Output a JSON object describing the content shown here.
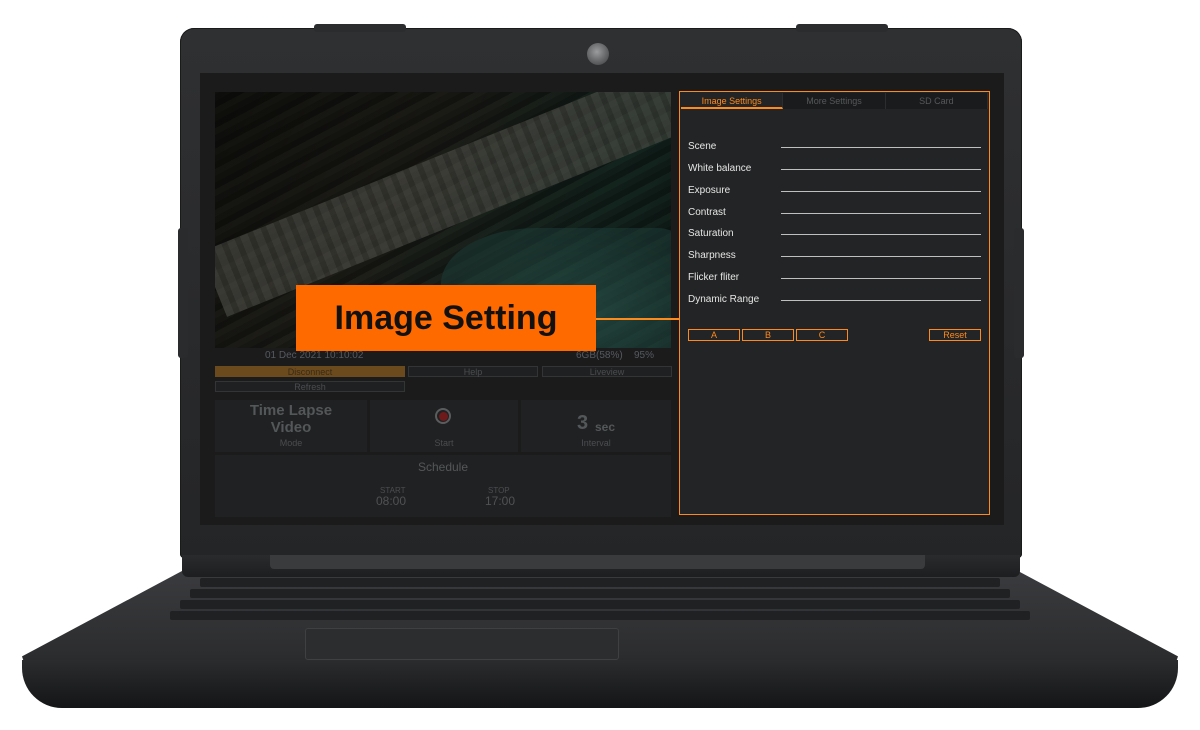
{
  "callout": {
    "label": "Image Setting"
  },
  "preview": {
    "timestamp": "01 Dec 2021 10:10:02",
    "storage": "6GB(58%)",
    "battery": "95%"
  },
  "controls": {
    "disconnect": "Disconnect",
    "help": "Help",
    "liveview": "Liveview",
    "refresh": "Refresh"
  },
  "mode": {
    "title_line1": "Time Lapse",
    "title_line2": "Video",
    "label": "Mode"
  },
  "start": {
    "label": "Start"
  },
  "interval": {
    "value": "3",
    "unit": "sec",
    "label": "Interval"
  },
  "schedule": {
    "title": "Schedule",
    "start_label": "START",
    "start_time": "08:00",
    "stop_label": "STOP",
    "stop_time": "17:00"
  },
  "panel": {
    "tabs": [
      {
        "label": "Image Settings",
        "active": true
      },
      {
        "label": "More Settings",
        "active": false
      },
      {
        "label": "SD Card",
        "active": false
      }
    ],
    "settings": [
      {
        "label": "Scene"
      },
      {
        "label": "White balance"
      },
      {
        "label": "Exposure"
      },
      {
        "label": "Contrast"
      },
      {
        "label": "Saturation"
      },
      {
        "label": "Sharpness"
      },
      {
        "label": "Flicker fliter"
      },
      {
        "label": "Dynamic Range"
      }
    ],
    "presets": [
      "A",
      "B",
      "C"
    ],
    "reset": "Reset"
  },
  "colors": {
    "accent": "#ff8a1c",
    "callout": "#ff6a00"
  }
}
